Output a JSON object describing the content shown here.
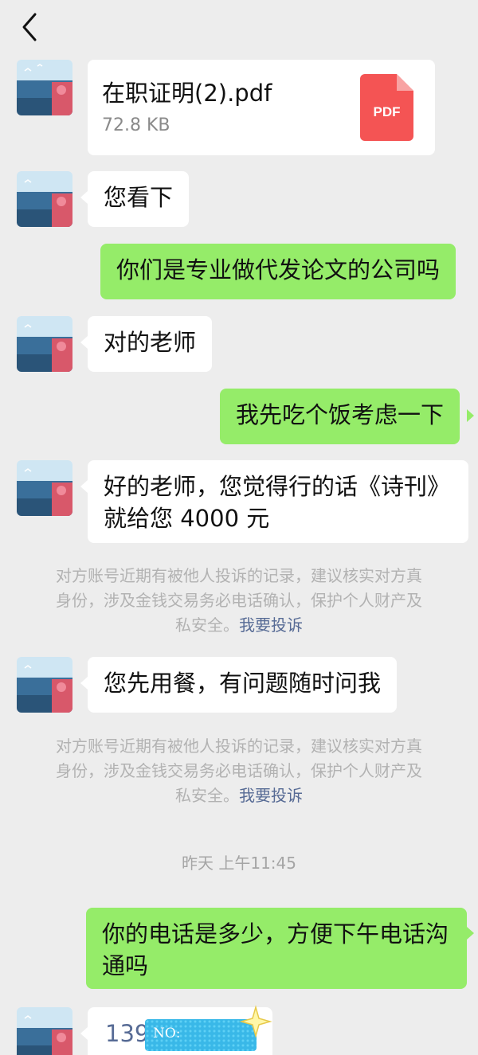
{
  "header": {
    "back_icon": "chevron-left-icon"
  },
  "messages": {
    "file": {
      "name": "在职证明(2).pdf",
      "size": "72.8 KB",
      "badge": "PDF",
      "badge_color": "#f45454"
    },
    "m1": "您看下",
    "m2": "你们是专业做代发论文的公司吗",
    "m3": "对的老师",
    "m4": "我先吃个饭考虑一下",
    "m5_line1": "好的老师，您觉得行的话《诗刊》",
    "m5_line2": "就给您 4000 元",
    "m6": "您先用餐，有问题随时问我",
    "m7_line1": "你的电话是多少，方便下午电话沟",
    "m7_line2": "通吗",
    "m8_visible": "139",
    "m8_redaction_text": "NO:"
  },
  "warning": {
    "line1": "对方账号近期有被他人投诉的记录，建议核实对方真",
    "line2": "身份，涉及金钱交易务必电话确认，保护个人财产及",
    "line3_prefix": "私安全。",
    "link": "我要投诉"
  },
  "timestamp": "昨天 上午11:45",
  "colors": {
    "incoming": "#ffffff",
    "outgoing": "#95ec69",
    "link": "#576b95",
    "background": "#ededed"
  }
}
